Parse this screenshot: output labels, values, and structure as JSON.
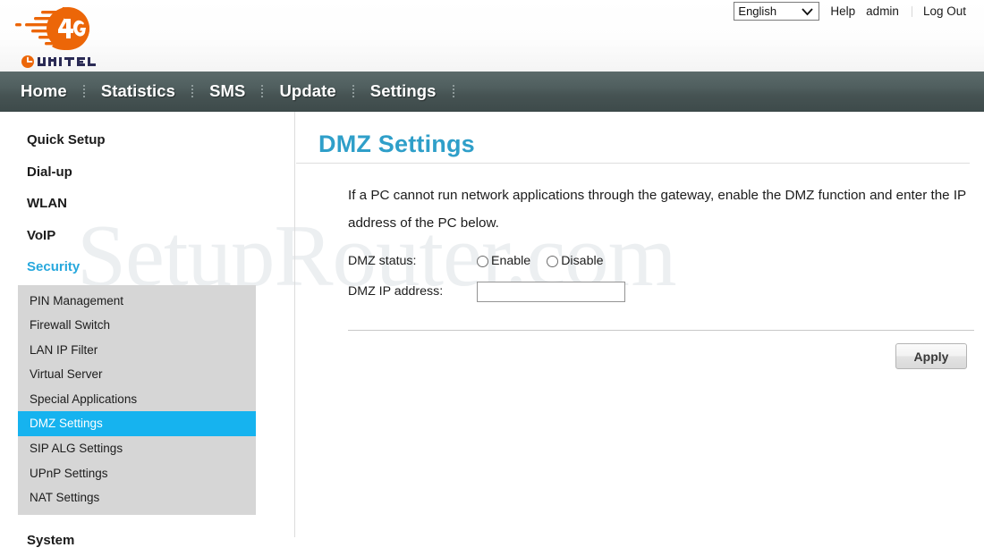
{
  "header": {
    "logo": {
      "badge_text": "4G",
      "brand_text": "UNITEL"
    },
    "language": {
      "selected": "English",
      "options": [
        "English"
      ]
    },
    "links": {
      "help": "Help",
      "user": "admin",
      "logout": "Log Out"
    }
  },
  "nav": {
    "items": [
      {
        "label": "Home"
      },
      {
        "label": "Statistics"
      },
      {
        "label": "SMS"
      },
      {
        "label": "Update"
      },
      {
        "label": "Settings"
      }
    ]
  },
  "sidebar": {
    "top_items": [
      {
        "label": "Quick Setup",
        "active": false
      },
      {
        "label": "Dial-up",
        "active": false
      },
      {
        "label": "WLAN",
        "active": false
      },
      {
        "label": "VoIP",
        "active": false
      },
      {
        "label": "Security",
        "active": true
      }
    ],
    "submenu": [
      {
        "label": "PIN Management",
        "active": false
      },
      {
        "label": "Firewall Switch",
        "active": false
      },
      {
        "label": "LAN IP Filter",
        "active": false
      },
      {
        "label": "Virtual Server",
        "active": false
      },
      {
        "label": "Special Applications",
        "active": false
      },
      {
        "label": "DMZ Settings",
        "active": true
      },
      {
        "label": "SIP ALG Settings",
        "active": false
      },
      {
        "label": "UPnP Settings",
        "active": false
      },
      {
        "label": "NAT Settings",
        "active": false
      }
    ],
    "bottom_items": [
      {
        "label": "System",
        "active": false
      }
    ]
  },
  "main": {
    "title": "DMZ Settings",
    "description": "If a PC cannot run network applications through the gateway, enable the DMZ function and enter the IP address of the PC below.",
    "fields": {
      "dmz_status_label": "DMZ status:",
      "dmz_status_options": [
        {
          "label": "Enable",
          "selected": false
        },
        {
          "label": "Disable",
          "selected": false
        }
      ],
      "dmz_ip_label": "DMZ IP address:",
      "dmz_ip_value": "",
      "dmz_ip_placeholder": ""
    },
    "apply_label": "Apply"
  },
  "watermark": {
    "text": "SetupRouter.com"
  },
  "colors": {
    "accent_blue": "#2f9fc9",
    "active_item_blue": "#16b3ef",
    "security_link_blue": "#27a8dd",
    "logo_orange": "#ec6608",
    "nav_dark": "#4f5e5e",
    "submenu_gray": "#d6d6d6"
  }
}
